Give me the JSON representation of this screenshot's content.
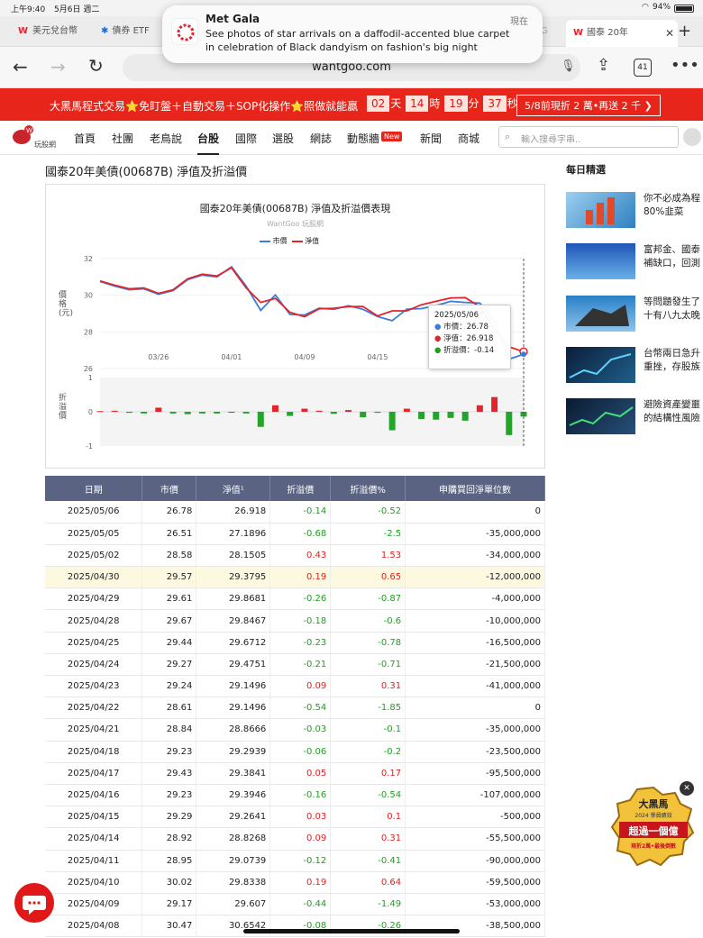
{
  "status": {
    "time": "上午9:40",
    "date": "5月6日 週二",
    "battery": "94%"
  },
  "tabs": [
    {
      "label": "美元兌台幣"
    },
    {
      "label": "債券 ETF"
    },
    {
      "label": "G"
    },
    {
      "label": "國泰 20年"
    }
  ],
  "notification": {
    "title": "Met Gala",
    "time": "現在",
    "body1": "See photos of star arrivals on a daffodil-accented blue carpet",
    "body2": "in celebration of Black dandyism on fashion's big night"
  },
  "browser": {
    "url": "wantgoo.com",
    "tab_count": "41"
  },
  "banner": {
    "text": "大黑馬程式交易⭐免盯盤＋自動交易＋SOP化操作⭐照做就能贏",
    "days": "02",
    "days_unit": "天",
    "hours": "14",
    "hours_unit": "時",
    "minutes": "19",
    "minutes_unit": "分",
    "seconds": "37",
    "seconds_unit": "秒",
    "cta": "5/8前現折 2 萬•再送 2 千 ❯"
  },
  "site": {
    "logo_text": "玩股網",
    "search_placeholder": "輸入搜尋字串..",
    "nav": [
      "首頁",
      "社團",
      "老鳥說",
      "台股",
      "國際",
      "選股",
      "網誌",
      "動態牆",
      "新聞",
      "商城"
    ],
    "nav_badge": "New"
  },
  "page": {
    "title": "國泰20年美債(00687B) 淨值及折溢價"
  },
  "chart_data": {
    "type": "line",
    "title": "國泰20年美債(00687B) 淨值及折溢價表現",
    "subtitle": "WantGoo 玩股網",
    "ylabel": "價格(元)",
    "ylabel2": "折溢價",
    "ylim": [
      26,
      32
    ],
    "ylim2": [
      -1,
      1
    ],
    "yticks": [
      "32",
      "30",
      "28",
      "26"
    ],
    "yticks2": [
      "1",
      "0",
      "-1"
    ],
    "xticks": [
      "03/26",
      "04/01",
      "04/09",
      "04/15",
      "04/21"
    ],
    "legend": [
      {
        "name": "市價",
        "color": "#3b7ddd"
      },
      {
        "name": "淨值",
        "color": "#e0262d"
      }
    ],
    "series": [
      {
        "name": "市價",
        "color": "#3b7ddd",
        "values": [
          30.75,
          30.5,
          30.3,
          30.35,
          30.05,
          30.25,
          30.85,
          31.1,
          31.0,
          31.55,
          30.5,
          29.17,
          30.02,
          28.95,
          28.92,
          29.29,
          29.23,
          29.43,
          29.23,
          28.84,
          28.61,
          29.24,
          29.27,
          29.44,
          29.67,
          29.61,
          29.57,
          28.58,
          26.51,
          26.78
        ]
      },
      {
        "name": "淨值",
        "color": "#e0262d",
        "values": [
          30.78,
          30.55,
          30.35,
          30.4,
          30.1,
          30.3,
          30.9,
          31.15,
          31.05,
          31.5,
          30.4,
          29.61,
          29.83,
          29.07,
          28.83,
          29.26,
          29.29,
          29.38,
          29.39,
          28.87,
          29.15,
          29.15,
          29.48,
          29.67,
          29.85,
          29.87,
          29.38,
          28.15,
          27.19,
          26.92
        ]
      }
    ],
    "premium_bars": [
      0.02,
      0.03,
      -0.03,
      -0.05,
      0.12,
      -0.05,
      -0.07,
      -0.05,
      -0.05,
      0.0,
      -0.05,
      -0.44,
      0.19,
      -0.12,
      0.09,
      0.03,
      -0.06,
      0.05,
      -0.16,
      -0.03,
      -0.54,
      0.09,
      -0.21,
      -0.23,
      -0.18,
      -0.26,
      0.19,
      0.43,
      -0.68,
      -0.14
    ],
    "tooltip": {
      "date": "2025/05/06",
      "market": "市價：26.78",
      "nav": "淨值：26.918",
      "premium": "折溢價：-0.14"
    }
  },
  "table": {
    "headers": [
      "日期",
      "市價",
      "淨值¹",
      "折溢價",
      "折溢價%",
      "申購買回淨單位數"
    ],
    "rows": [
      [
        "2025/05/06",
        "26.78",
        "26.918",
        "-0.14",
        "-0.52",
        "0"
      ],
      [
        "2025/05/05",
        "26.51",
        "27.1896",
        "-0.68",
        "-2.5",
        "-35,000,000"
      ],
      [
        "2025/05/02",
        "28.58",
        "28.1505",
        "0.43",
        "1.53",
        "-34,000,000"
      ],
      [
        "2025/04/30",
        "29.57",
        "29.3795",
        "0.19",
        "0.65",
        "-12,000,000"
      ],
      [
        "2025/04/29",
        "29.61",
        "29.8681",
        "-0.26",
        "-0.87",
        "-4,000,000"
      ],
      [
        "2025/04/28",
        "29.67",
        "29.8467",
        "-0.18",
        "-0.6",
        "-10,000,000"
      ],
      [
        "2025/04/25",
        "29.44",
        "29.6712",
        "-0.23",
        "-0.78",
        "-16,500,000"
      ],
      [
        "2025/04/24",
        "29.27",
        "29.4751",
        "-0.21",
        "-0.71",
        "-21,500,000"
      ],
      [
        "2025/04/23",
        "29.24",
        "29.1496",
        "0.09",
        "0.31",
        "-41,000,000"
      ],
      [
        "2025/04/22",
        "28.61",
        "29.1496",
        "-0.54",
        "-1.85",
        "0"
      ],
      [
        "2025/04/21",
        "28.84",
        "28.8666",
        "-0.03",
        "-0.1",
        "-35,000,000"
      ],
      [
        "2025/04/18",
        "29.23",
        "29.2939",
        "-0.06",
        "-0.2",
        "-23,500,000"
      ],
      [
        "2025/04/17",
        "29.43",
        "29.3841",
        "0.05",
        "0.17",
        "-95,500,000"
      ],
      [
        "2025/04/16",
        "29.23",
        "29.3946",
        "-0.16",
        "-0.54",
        "-107,000,000"
      ],
      [
        "2025/04/15",
        "29.29",
        "29.2641",
        "0.03",
        "0.1",
        "-500,000"
      ],
      [
        "2025/04/14",
        "28.92",
        "28.8268",
        "0.09",
        "0.31",
        "-55,500,000"
      ],
      [
        "2025/04/11",
        "28.95",
        "29.0739",
        "-0.12",
        "-0.41",
        "-90,000,000"
      ],
      [
        "2025/04/10",
        "30.02",
        "29.8338",
        "0.19",
        "0.64",
        "-59,500,000"
      ],
      [
        "2025/04/09",
        "29.17",
        "29.607",
        "-0.44",
        "-1.49",
        "-53,000,000"
      ],
      [
        "2025/04/08",
        "30.47",
        "30.6542",
        "-0.08",
        "-0.26",
        "-38,500,000"
      ]
    ]
  },
  "sidebar": {
    "title": "每日精選",
    "news": [
      {
        "line1": "你不必成為程",
        "line2": "80%韭菜"
      },
      {
        "line1": "富邦金、國泰",
        "line2": "補缺口，回測"
      },
      {
        "line1": "等問題發生了",
        "line2": "十有八九太晚"
      },
      {
        "line1": "台幣兩日急升",
        "line2": "重挫，存股族"
      },
      {
        "line1": "避險資產變噩",
        "line2": "的結構性風險"
      }
    ]
  },
  "promo": {
    "line1": "大黑馬",
    "line2": "2024 學員績效",
    "line3": "超過一個億",
    "line4": "現折2萬•最後倒數"
  }
}
